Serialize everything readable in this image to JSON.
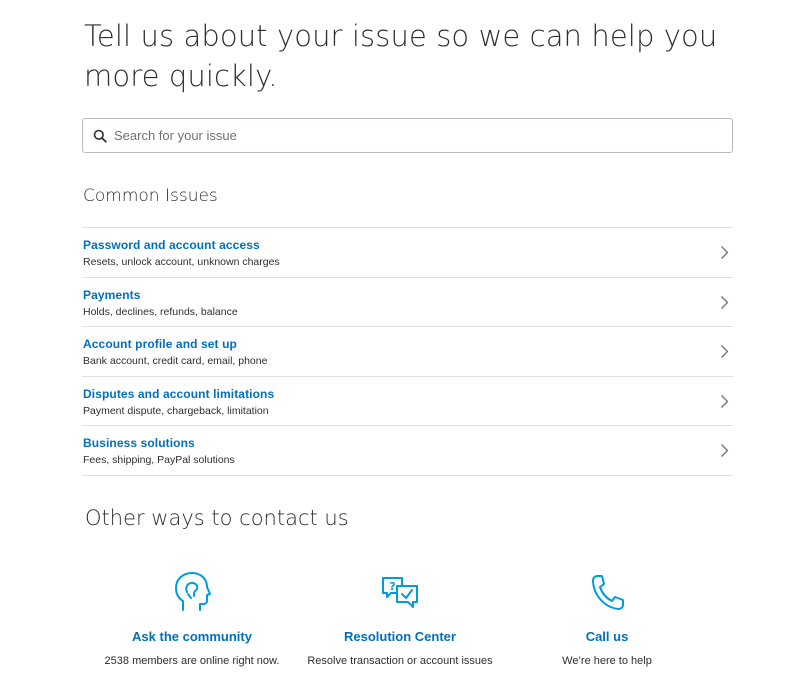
{
  "page": {
    "title": "Tell us about your issue so we can help you more quickly."
  },
  "search": {
    "placeholder": "Search for your issue",
    "value": ""
  },
  "common_issues": {
    "heading": "Common Issues",
    "items": [
      {
        "title": "Password and account access",
        "description": "Resets, unlock account, unknown charges"
      },
      {
        "title": "Payments",
        "description": "Holds, declines, refunds, balance"
      },
      {
        "title": "Account profile and set up",
        "description": "Bank account, credit card, email, phone"
      },
      {
        "title": "Disputes and account limitations",
        "description": "Payment dispute, chargeback, limitation"
      },
      {
        "title": "Business solutions",
        "description": "Fees, shipping, PayPal solutions"
      }
    ]
  },
  "contact": {
    "heading": "Other ways to contact us",
    "options": [
      {
        "icon": "community-head-icon",
        "title": "Ask the community",
        "description": "2538 members are online right now."
      },
      {
        "icon": "chat-bubbles-icon",
        "title": "Resolution Center",
        "description": "Resolve transaction or account issues"
      },
      {
        "icon": "phone-icon",
        "title": "Call us",
        "description": "We’re here to help"
      }
    ]
  },
  "colors": {
    "link": "#0070ba",
    "text": "#2c2e2f",
    "icon": "#009cde",
    "divider": "#dfe1e3"
  }
}
